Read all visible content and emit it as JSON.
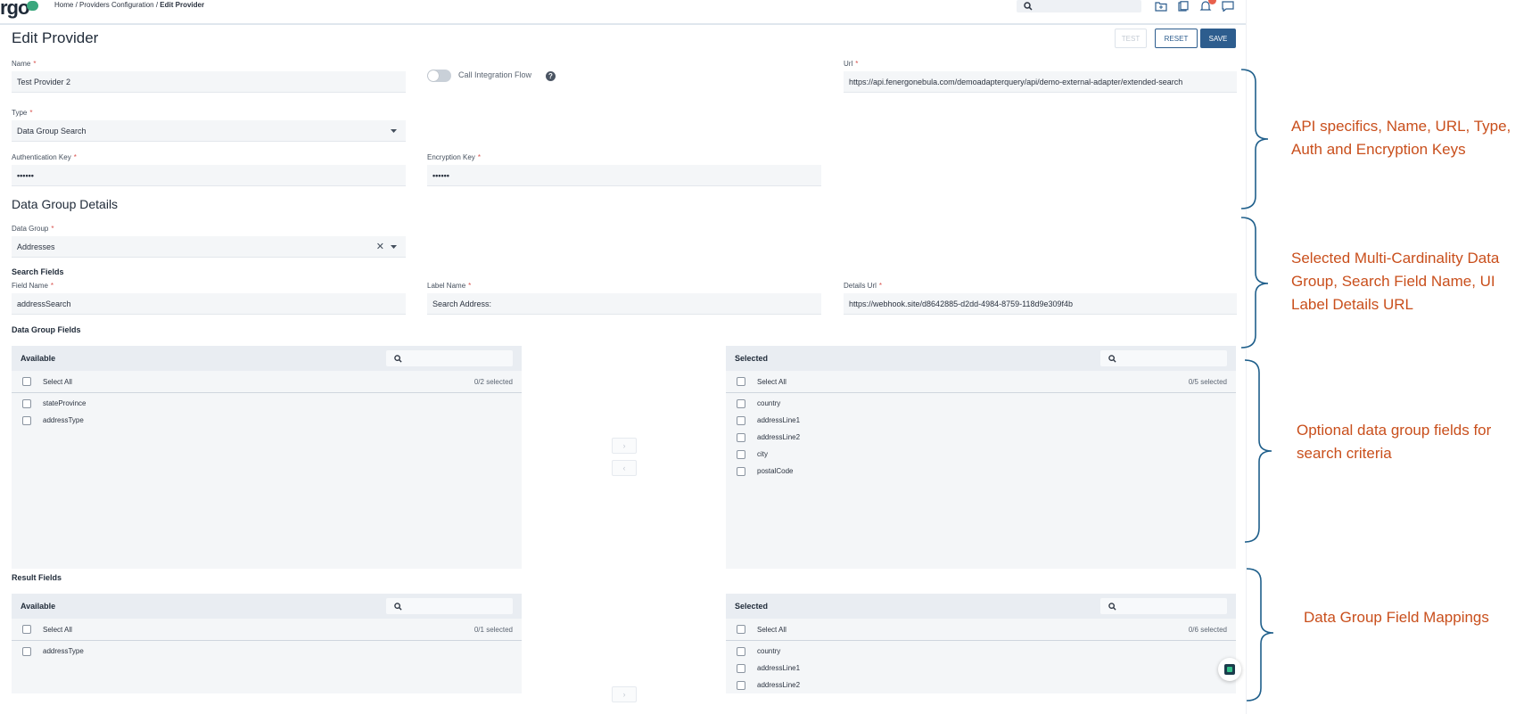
{
  "app": {
    "logo": "rgo",
    "breadcrumb": {
      "home": "Home",
      "sep": " / ",
      "section": "Providers Configuration",
      "current": "Edit Provider"
    }
  },
  "page": {
    "title": "Edit Provider",
    "buttons": {
      "test": "TEST",
      "reset": "RESET",
      "save": "SAVE"
    }
  },
  "form": {
    "name": {
      "label": "Name",
      "value": "Test Provider 2"
    },
    "call_integration_flow": {
      "label": "Call Integration Flow",
      "enabled": false
    },
    "url": {
      "label": "Url",
      "value": "https://api.fenergonebula.com/demoadapterquery/api/demo-external-adapter/extended-search"
    },
    "type": {
      "label": "Type",
      "value": "Data Group Search"
    },
    "auth_key": {
      "label": "Authentication Key",
      "value": "••••••"
    },
    "encryption_key": {
      "label": "Encryption Key",
      "value": "••••••"
    }
  },
  "data_group_details": {
    "title": "Data Group Details",
    "data_group": {
      "label": "Data Group",
      "value": "Addresses"
    },
    "search_fields_title": "Search Fields",
    "field_name": {
      "label": "Field Name",
      "value": "addressSearch"
    },
    "label_name": {
      "label": "Label Name",
      "value": "Search Address:"
    },
    "details_url": {
      "label": "Details Url",
      "value": "https://webhook.site/d8642885-d2dd-4984-8759-118d9e309f4b"
    }
  },
  "data_group_fields": {
    "title": "Data Group Fields",
    "available": {
      "title": "Available",
      "select_all": "Select All",
      "count": "0/2 selected",
      "items": [
        "stateProvince",
        "addressType"
      ]
    },
    "selected": {
      "title": "Selected",
      "select_all": "Select All",
      "count": "0/5 selected",
      "items": [
        "country",
        "addressLine1",
        "addressLine2",
        "city",
        "postalCode"
      ]
    },
    "move_right": "›",
    "move_left": "‹"
  },
  "result_fields": {
    "title": "Result Fields",
    "available": {
      "title": "Available",
      "select_all": "Select All",
      "count": "0/1 selected",
      "items": [
        "addressType"
      ]
    },
    "selected": {
      "title": "Selected",
      "select_all": "Select All",
      "count": "0/6 selected",
      "items": [
        "country",
        "addressLine1",
        "addressLine2"
      ]
    }
  },
  "annotations": [
    {
      "line1": "API specifics, Name, URL, Type,",
      "line2": "Auth and Encryption Keys"
    },
    {
      "line1": "Selected Multi-Cardinality Data",
      "line2": "Group, Search Field Name, UI",
      "line3": "Label Details URL"
    },
    {
      "line1": "Optional data group fields for",
      "line2": "search criteria"
    },
    {
      "line1": "Data Group Field Mappings"
    }
  ],
  "colors": {
    "accent": "#2d5d8e",
    "annotation": "#c94f1c",
    "bracket": "#1f5f8b",
    "brand": "#3aa77d"
  }
}
